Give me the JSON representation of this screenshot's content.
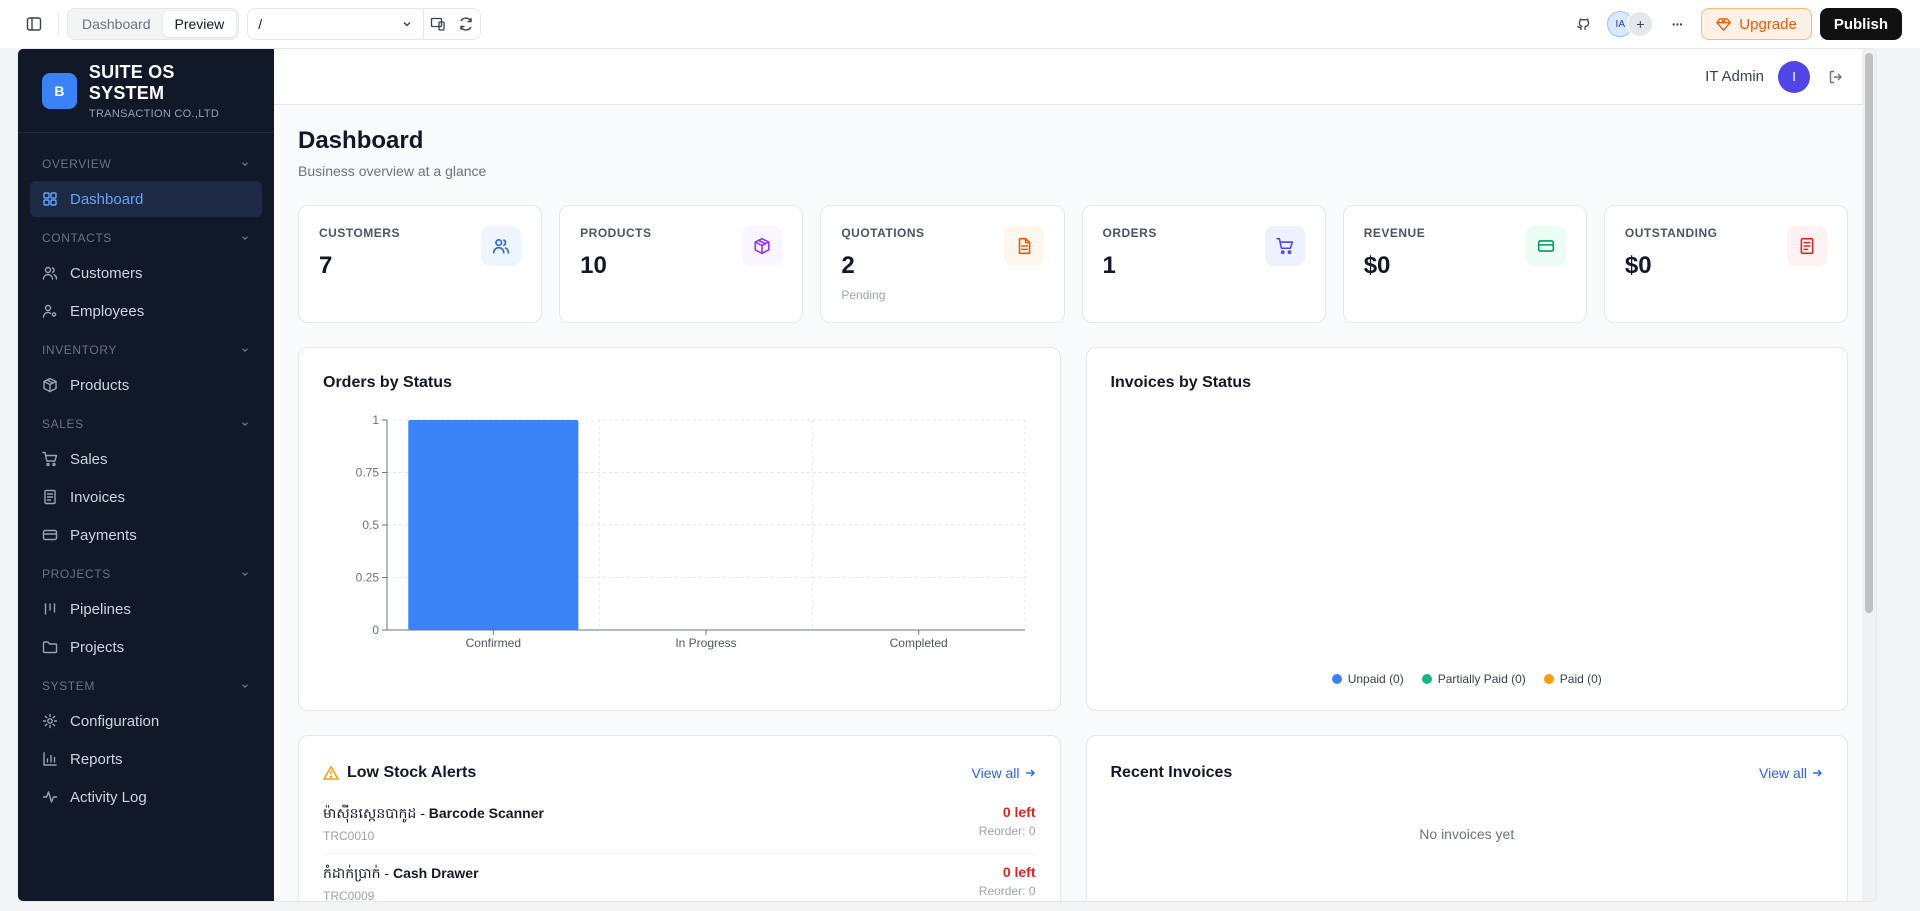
{
  "topbar": {
    "tab_dashboard": "Dashboard",
    "tab_preview": "Preview",
    "url": "/",
    "avatar_initials": "IA",
    "add": "+",
    "more": "···",
    "upgrade_label": "Upgrade",
    "publish_label": "Publish"
  },
  "brand": {
    "logo_letter": "B",
    "name": "SUITE OS SYSTEM",
    "subtitle": "TRANSACTION CO.,LTD"
  },
  "sidebar": {
    "sections": [
      {
        "label": "OVERVIEW",
        "items": [
          {
            "label": "Dashboard",
            "icon": "grid-icon",
            "active": true
          }
        ]
      },
      {
        "label": "CONTACTS",
        "items": [
          {
            "label": "Customers",
            "icon": "users-icon"
          },
          {
            "label": "Employees",
            "icon": "user-cog-icon"
          }
        ]
      },
      {
        "label": "INVENTORY",
        "items": [
          {
            "label": "Products",
            "icon": "package-icon"
          }
        ]
      },
      {
        "label": "SALES",
        "items": [
          {
            "label": "Sales",
            "icon": "cart-icon"
          },
          {
            "label": "Invoices",
            "icon": "receipt-icon"
          },
          {
            "label": "Payments",
            "icon": "credit-card-icon"
          }
        ]
      },
      {
        "label": "PROJECTS",
        "items": [
          {
            "label": "Pipelines",
            "icon": "kanban-icon"
          },
          {
            "label": "Projects",
            "icon": "folder-icon"
          }
        ]
      },
      {
        "label": "SYSTEM",
        "items": [
          {
            "label": "Configuration",
            "icon": "gear-icon"
          },
          {
            "label": "Reports",
            "icon": "bar-chart-icon"
          },
          {
            "label": "Activity Log",
            "icon": "activity-icon"
          }
        ]
      }
    ]
  },
  "header": {
    "user_name": "IT Admin",
    "user_initial": "I"
  },
  "page": {
    "title": "Dashboard",
    "subtitle": "Business overview at a glance"
  },
  "stats": [
    {
      "label": "CUSTOMERS",
      "value": "7",
      "note": "",
      "icon": "users-icon",
      "color": "#2563eb",
      "bg": "#eff6ff"
    },
    {
      "label": "PRODUCTS",
      "value": "10",
      "note": "",
      "icon": "package-icon",
      "color": "#9333ea",
      "bg": "#faf5ff"
    },
    {
      "label": "QUOTATIONS",
      "value": "2",
      "note": "Pending",
      "icon": "document-icon",
      "color": "#ea580c",
      "bg": "#fff7ed"
    },
    {
      "label": "ORDERS",
      "value": "1",
      "note": "",
      "icon": "cart-icon",
      "color": "#4f46e5",
      "bg": "#eef2ff"
    },
    {
      "label": "REVENUE",
      "value": "$0",
      "note": "",
      "icon": "credit-card-icon",
      "color": "#059669",
      "bg": "#ecfdf5"
    },
    {
      "label": "OUTSTANDING",
      "value": "$0",
      "note": "",
      "icon": "receipt-icon",
      "color": "#dc2626",
      "bg": "#fef2f2"
    }
  ],
  "orders_chart": {
    "title": "Orders by Status"
  },
  "invoices_chart": {
    "title": "Invoices by Status",
    "legend": [
      {
        "label": "Unpaid (0)",
        "color": "#3b82f6"
      },
      {
        "label": "Partially Paid (0)",
        "color": "#10b981"
      },
      {
        "label": "Paid (0)",
        "color": "#f59e0b"
      }
    ]
  },
  "chart_data": {
    "type": "bar",
    "title": "Orders by Status",
    "categories": [
      "Confirmed",
      "In Progress",
      "Completed"
    ],
    "values": [
      1,
      0,
      0
    ],
    "ylim": [
      0,
      1
    ],
    "yticks": [
      "0",
      "0.25",
      "0.5",
      "0.75",
      "1"
    ],
    "color": "#3b82f6",
    "grid": true
  },
  "low_stock": {
    "title": "Low Stock Alerts",
    "view_all": "View all",
    "items": [
      {
        "name_km": "ម៉ាស៊ីនស្កេនបាកូដ",
        "sep": " - ",
        "name": "Barcode Scanner",
        "sku": "TRC0010",
        "left": "0 left",
        "reorder": "Reorder: 0"
      },
      {
        "name_km": "កំដាក់ប្រាក់",
        "sep": " - ",
        "name": "Cash Drawer",
        "sku": "TRC0009",
        "left": "0 left",
        "reorder": "Reorder: 0"
      }
    ]
  },
  "recent_invoices": {
    "title": "Recent Invoices",
    "view_all": "View all",
    "empty": "No invoices yet"
  }
}
